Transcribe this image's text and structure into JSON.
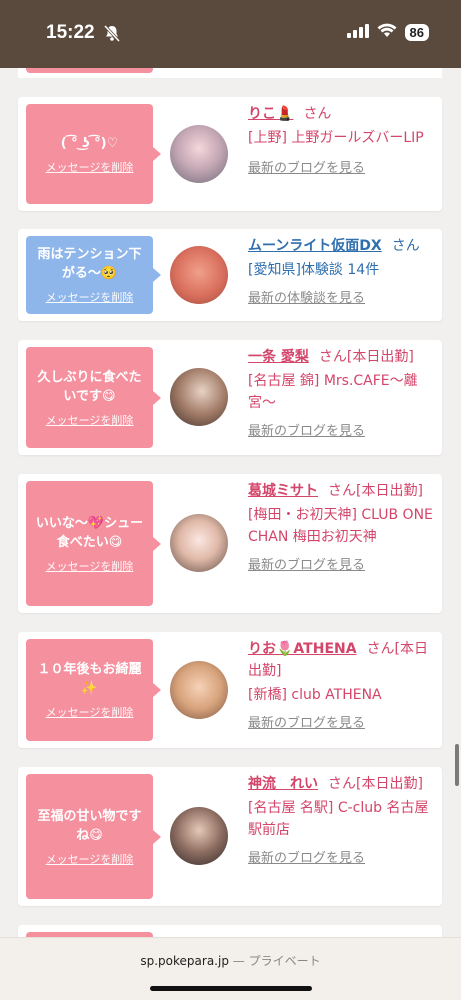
{
  "status_bar": {
    "time": "15:22",
    "battery": "86"
  },
  "messages": [
    {
      "bubble_text": "( ͡° ͜ʖ ͡°)♡",
      "delete_label": "メッセージを削除",
      "name": "りこ💄",
      "san": "さん",
      "shop": "[上野] 上野ガールズバーLIP",
      "link": "最新のブログを見る",
      "bubble_color": "#f5919f"
    },
    {
      "bubble_text": "雨はテンション下がる〜🥺",
      "delete_label": "メッセージを削除",
      "name": "ムーンライト仮面DX",
      "san": "さん",
      "shop": "[愛知県]体験談 14件",
      "link": "最新の体験談を見る",
      "bubble_color": "#8fb6ea"
    },
    {
      "bubble_text": "久しぶりに食べたいです😋",
      "delete_label": "メッセージを削除",
      "name": "一条 愛梨",
      "san": "さん[本日出勤]",
      "shop": "[名古屋 錦] Mrs.CAFE〜離宮〜",
      "link": "最新のブログを見る",
      "bubble_color": "#f5919f"
    },
    {
      "bubble_text": "いいな〜💖シュー食べたい😋",
      "delete_label": "メッセージを削除",
      "name": "葛城ミサト",
      "san": "さん[本日出勤]",
      "shop": "[梅田・お初天神] CLUB ONE CHAN 梅田お初天神",
      "link": "最新のブログを見る",
      "bubble_color": "#f5919f"
    },
    {
      "bubble_text": "１０年後もお綺麗✨",
      "delete_label": "メッセージを削除",
      "name": "りお🌷ATHENA",
      "san": "さん[本日出勤]",
      "shop": "[新橋] club ATHENA",
      "link": "最新のブログを見る",
      "bubble_color": "#f5919f"
    },
    {
      "bubble_text": "至福の甘い物ですね😋",
      "delete_label": "メッセージを削除",
      "name": "神流　れい",
      "san": "さん[本日出勤]",
      "shop": "[名古屋 名駅] C-club 名古屋駅前店",
      "link": "最新のブログを見る",
      "bubble_color": "#f5919f"
    }
  ],
  "browser": {
    "domain": "sp.pokepara.jp",
    "separator": "—",
    "mode": "プライベート"
  }
}
